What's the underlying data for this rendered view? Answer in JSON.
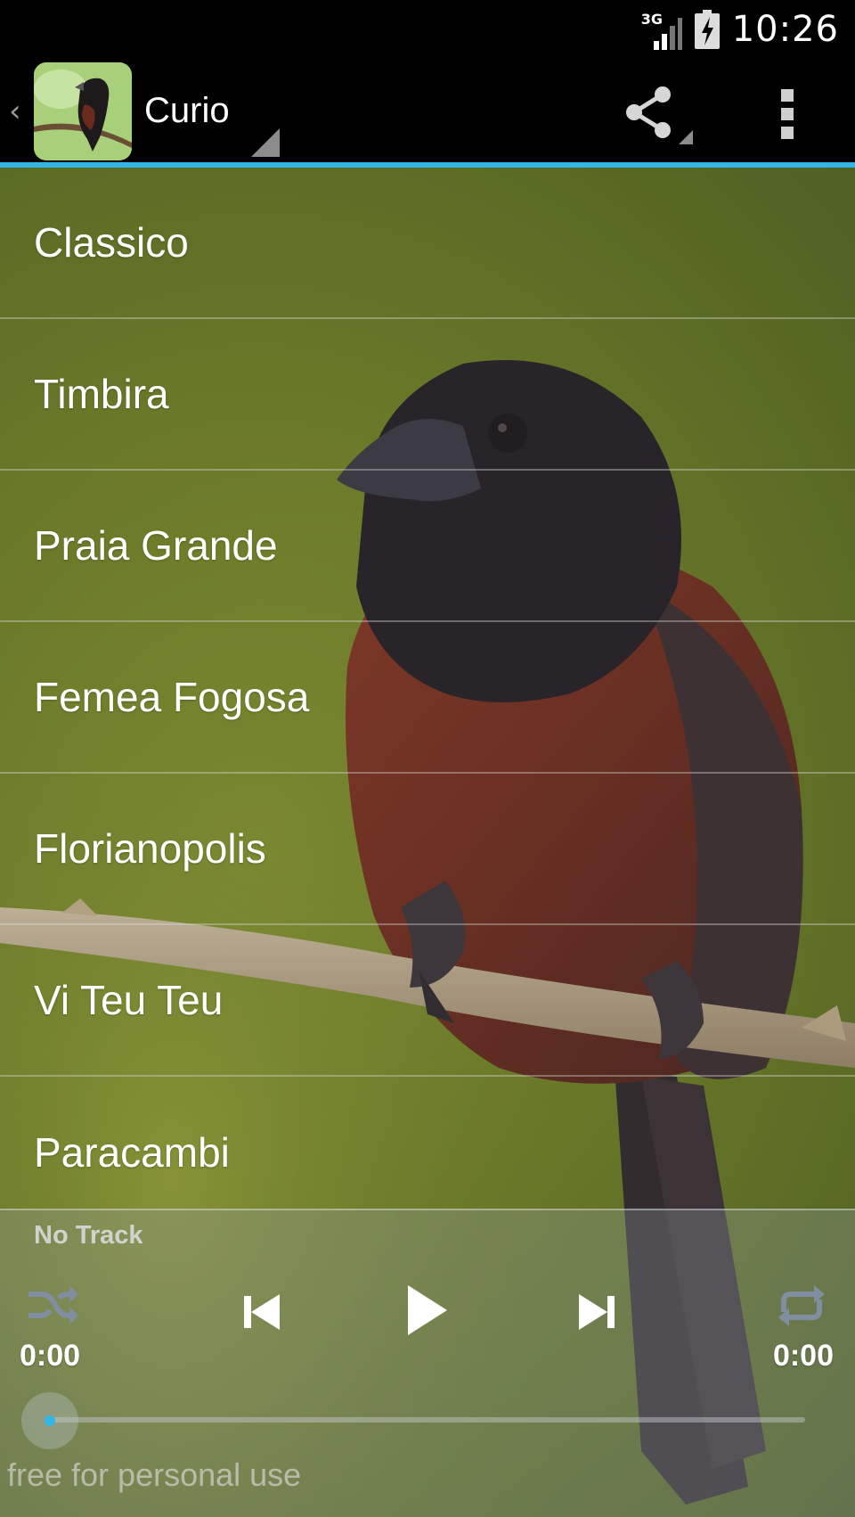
{
  "status_bar": {
    "network_type": "3G",
    "time": "10:26"
  },
  "action_bar": {
    "title": "Curio",
    "icons": [
      "up-caret-icon",
      "app-icon",
      "share-icon",
      "overflow-menu-icon"
    ]
  },
  "tracks": [
    {
      "label": "Classico"
    },
    {
      "label": "Timbira"
    },
    {
      "label": "Praia Grande"
    },
    {
      "label": "Femea Fogosa"
    },
    {
      "label": "Florianopolis"
    },
    {
      "label": "Vi Teu Teu"
    },
    {
      "label": "Paracambi"
    }
  ],
  "player": {
    "track_title": "No Track",
    "elapsed": "0:00",
    "total": "0:00",
    "progress": 0,
    "icons": [
      "shuffle-icon",
      "previous-icon",
      "play-icon",
      "next-icon",
      "repeat-icon"
    ]
  },
  "watermark": "free for personal use",
  "colors": {
    "accent": "#33b5e5",
    "background": "#000000"
  }
}
